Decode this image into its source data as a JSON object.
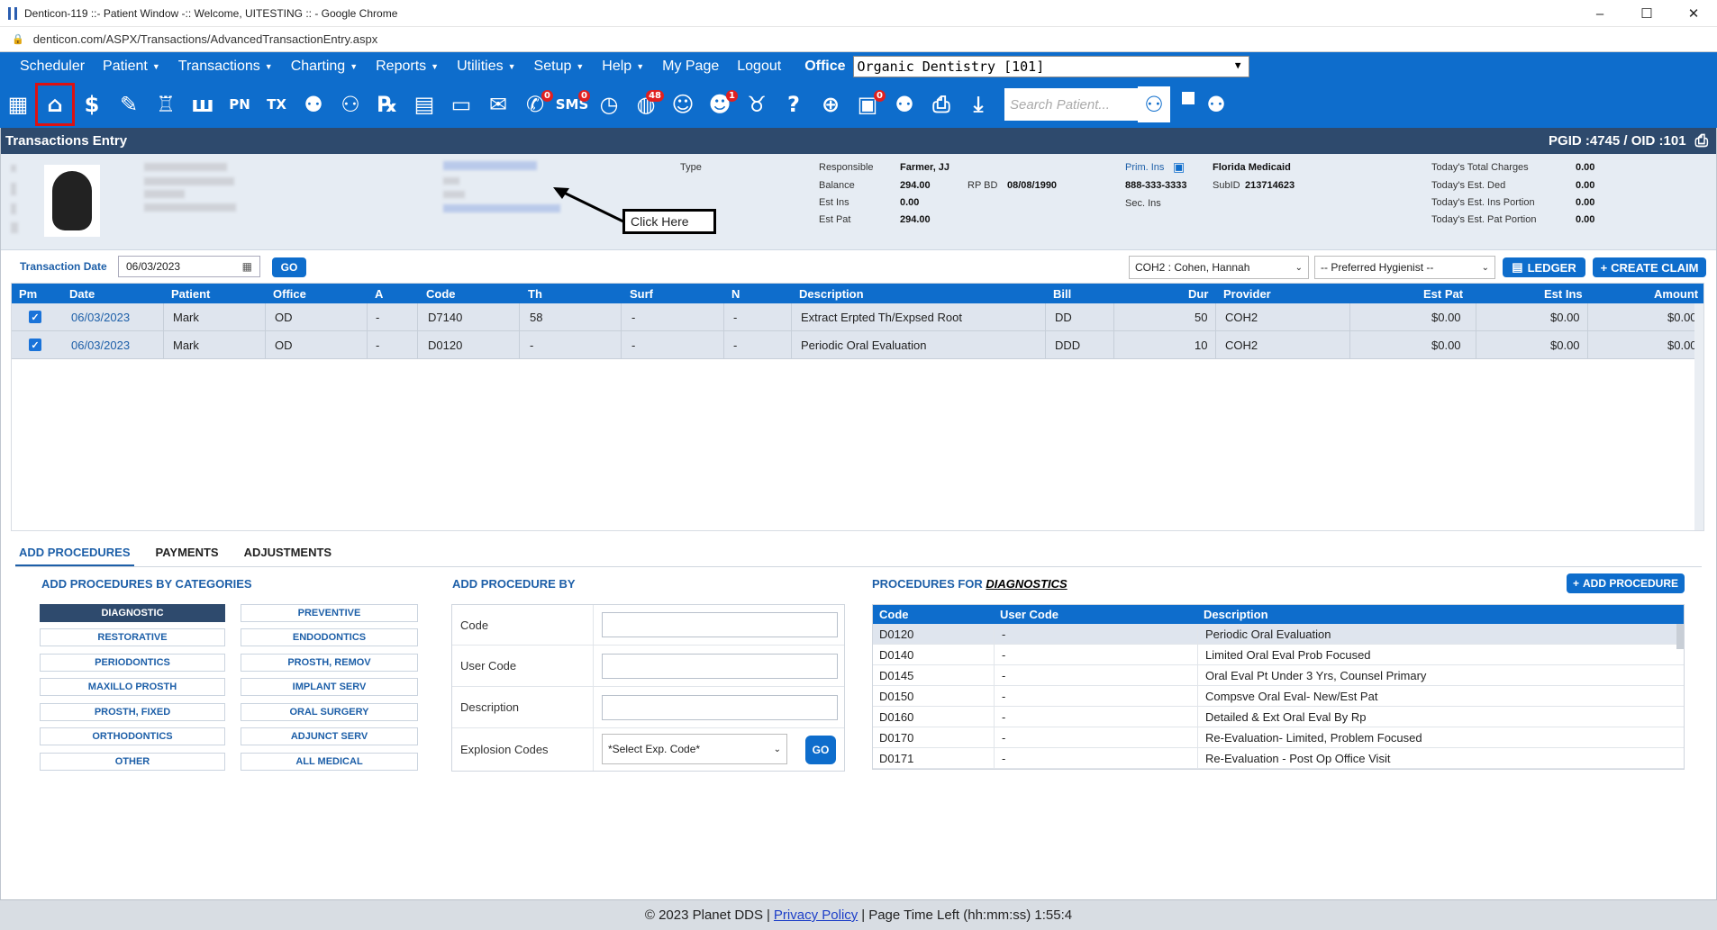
{
  "window": {
    "title": "Denticon-119 ::- Patient Window -:: Welcome, UITESTING :: - Google Chrome",
    "url": "denticon.com/ASPX/Transactions/AdvancedTransactionEntry.aspx"
  },
  "menu": {
    "items": [
      "Scheduler",
      "Patient",
      "Transactions",
      "Charting",
      "Reports",
      "Utilities",
      "Setup",
      "Help",
      "My Page",
      "Logout"
    ],
    "office_label": "Office",
    "office_value": "Organic Dentistry [101]"
  },
  "toolbar": {
    "search_placeholder": "Search Patient...",
    "pn": "PN",
    "tx": "TX",
    "sms": "SMS",
    "badges": {
      "messages": "0",
      "sms": "0",
      "web": "48",
      "alerts": "1",
      "forms": "0"
    }
  },
  "header": {
    "title": "Transactions Entry",
    "ids": "PGID :4745  /  OID :101"
  },
  "patient": {
    "type_label": "Type",
    "responsible_label": "Responsible",
    "responsible": "Farmer, JJ",
    "balance_label": "Balance",
    "balance": "294.00",
    "rpbd_label": "RP BD",
    "rpbd": "08/08/1990",
    "est_ins_label": "Est Ins",
    "est_ins": "0.00",
    "est_pat_label": "Est Pat",
    "est_pat": "294.00",
    "prim_ins_label": "Prim. Ins",
    "prim_ins": "Florida Medicaid",
    "phone": "888-333-3333",
    "subid_label": "SubID",
    "subid": "213714623",
    "sec_ins_label": "Sec. Ins",
    "totals": [
      {
        "label": "Today's Total Charges",
        "value": "0.00"
      },
      {
        "label": "Today's Est. Ded",
        "value": "0.00"
      },
      {
        "label": "Today's Est. Ins Portion",
        "value": "0.00"
      },
      {
        "label": "Today's Est. Pat Portion",
        "value": "0.00"
      }
    ]
  },
  "callout": "Click Here",
  "transaction": {
    "date_label": "Transaction Date",
    "date_value": "06/03/2023",
    "go": "GO",
    "provider": "COH2 : Cohen, Hannah",
    "hygienist": "-- Preferred Hygienist --",
    "ledger": "LEDGER",
    "create_claim": "CREATE CLAIM"
  },
  "grid": {
    "columns": [
      "Pm",
      "Date",
      "Patient",
      "Office",
      "A",
      "Code",
      "Th",
      "Surf",
      "N",
      "Description",
      "Bill",
      "Dur",
      "Provider",
      "Est Pat",
      "Est Ins",
      "Amount"
    ],
    "rows": [
      {
        "date": "06/03/2023",
        "patient": "Mark",
        "office": "OD",
        "a": "-",
        "code": "D7140",
        "th": "58",
        "surf": "-",
        "n": "-",
        "desc": "Extract Erpted Th/Expsed Root",
        "bill": "DD",
        "dur": "50",
        "provider": "COH2",
        "est_pat": "$0.00",
        "est_ins": "$0.00",
        "amount": "$0.00"
      },
      {
        "date": "06/03/2023",
        "patient": "Mark",
        "office": "OD",
        "a": "-",
        "code": "D0120",
        "th": "-",
        "surf": "-",
        "n": "-",
        "desc": "Periodic Oral Evaluation",
        "bill": "DDD",
        "dur": "10",
        "provider": "COH2",
        "est_pat": "$0.00",
        "est_ins": "$0.00",
        "amount": "$0.00"
      }
    ]
  },
  "tabs": [
    "ADD PROCEDURES",
    "PAYMENTS",
    "ADJUSTMENTS"
  ],
  "categories": {
    "title": "ADD PROCEDURES BY CATEGORIES",
    "left": [
      "DIAGNOSTIC",
      "RESTORATIVE",
      "PERIODONTICS",
      "MAXILLO PROSTH",
      "PROSTH, FIXED",
      "ORTHODONTICS",
      "OTHER"
    ],
    "right": [
      "PREVENTIVE",
      "ENDODONTICS",
      "PROSTH, REMOV",
      "IMPLANT SERV",
      "ORAL SURGERY",
      "ADJUNCT SERV",
      "ALL MEDICAL"
    ]
  },
  "add_by": {
    "title": "ADD PROCEDURE BY",
    "code": "Code",
    "user_code": "User Code",
    "description": "Description",
    "explosion": "Explosion Codes",
    "select": "*Select Exp. Code*",
    "go": "GO"
  },
  "procedures": {
    "title_prefix": "PROCEDURES FOR ",
    "title_cat": "DIAGNOSTICS",
    "add_button": "ADD PROCEDURE",
    "columns": [
      "Code",
      "User Code",
      "Description"
    ],
    "rows": [
      {
        "code": "D0120",
        "user": "-",
        "desc": "Periodic Oral Evaluation"
      },
      {
        "code": "D0140",
        "user": "-",
        "desc": "Limited Oral Eval Prob Focused"
      },
      {
        "code": "D0145",
        "user": "-",
        "desc": "Oral Eval Pt Under 3 Yrs, Counsel Primary"
      },
      {
        "code": "D0150",
        "user": "-",
        "desc": "Compsve Oral Eval- New/Est Pat"
      },
      {
        "code": "D0160",
        "user": "-",
        "desc": "Detailed & Ext Oral Eval By Rp"
      },
      {
        "code": "D0170",
        "user": "-",
        "desc": "Re-Evaluation- Limited, Problem Focused"
      },
      {
        "code": "D0171",
        "user": "-",
        "desc": "Re-Evaluation - Post Op Office Visit"
      }
    ]
  },
  "footer": {
    "copyright": "© 2023 Planet DDS",
    "sep1": "|",
    "privacy": "Privacy Policy",
    "sep2": "|",
    "time_left": "Page Time Left (hh:mm:ss) 1:55:4"
  }
}
